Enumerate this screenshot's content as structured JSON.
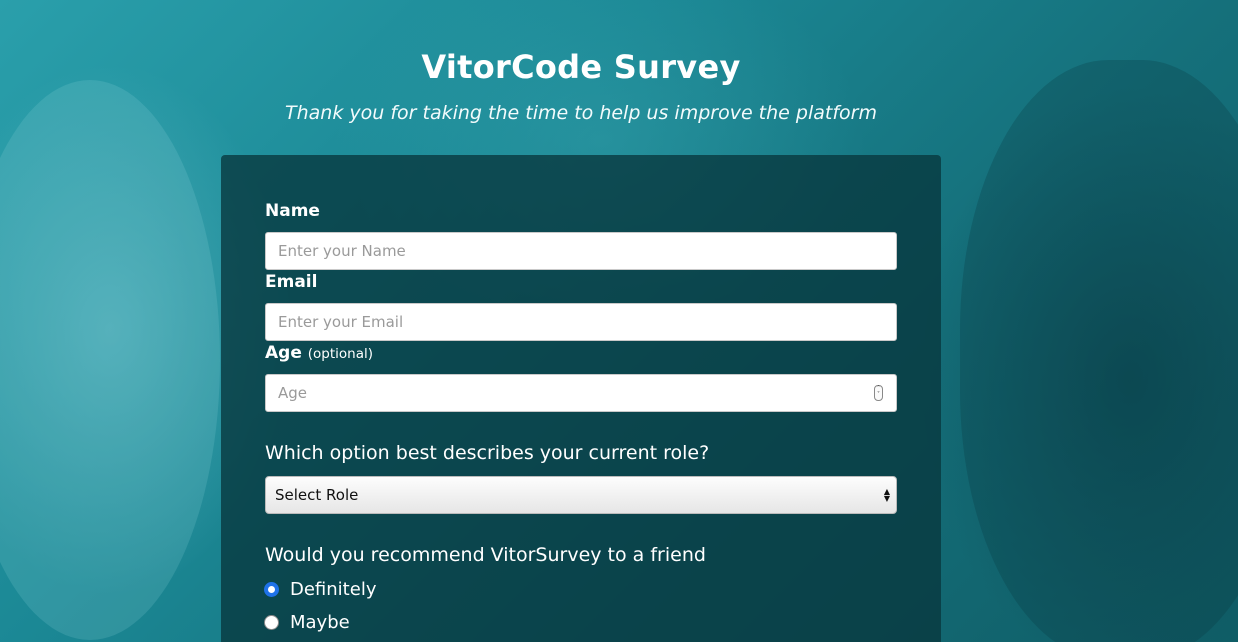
{
  "header": {
    "title": "VitorCode Survey",
    "subtitle": "Thank you for taking the time to help us improve the platform"
  },
  "form": {
    "name": {
      "label": "Name",
      "placeholder": "Enter your Name",
      "value": ""
    },
    "email": {
      "label": "Email",
      "placeholder": "Enter your Email",
      "value": ""
    },
    "age": {
      "label": "Age",
      "optional": "(optional)",
      "placeholder": "Age",
      "value": ""
    },
    "role": {
      "question": "Which option best describes your current role?",
      "selected": "Select Role"
    },
    "recommend": {
      "question": "Would you recommend VitorSurvey to a friend",
      "options": [
        {
          "label": "Definitely",
          "checked": true
        },
        {
          "label": "Maybe",
          "checked": false
        }
      ]
    }
  },
  "colors": {
    "background_teal": "#1e8a96",
    "card": "#08373e",
    "radio_accent": "#1f72e8",
    "text": "#ffffff"
  }
}
